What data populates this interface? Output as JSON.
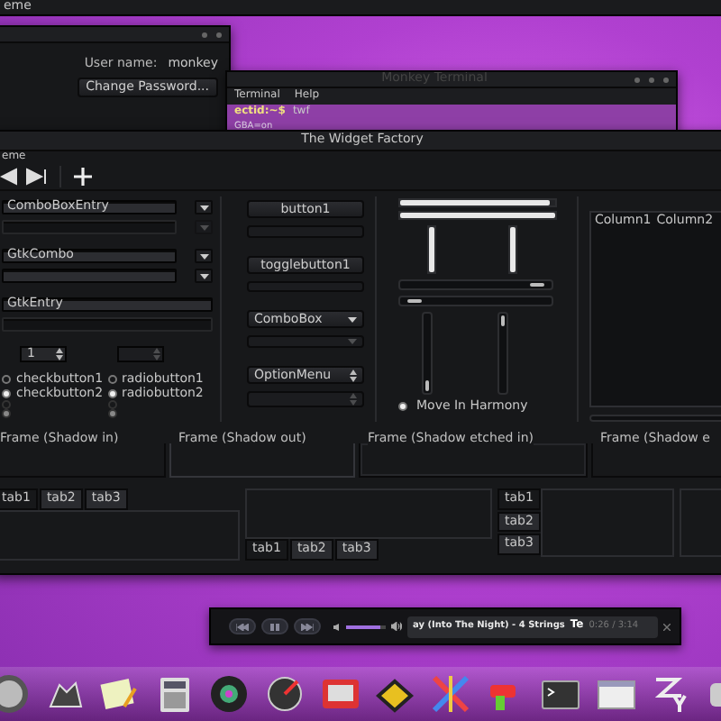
{
  "top_bar": {
    "title": "eme"
  },
  "account_window": {
    "user_label": "User name:",
    "user_value": "monkey",
    "button": "Change Password..."
  },
  "terminal_window": {
    "title": "Monkey Terminal",
    "menu": [
      "Terminal",
      "Help"
    ],
    "prompt": "ectid:~$",
    "command": "twf",
    "output": "GBA=on"
  },
  "widget_factory": {
    "title": "The Widget Factory",
    "menu_title": "eme",
    "rows": [
      {
        "kind": "combo",
        "value": "ComboBoxEntry",
        "disabled": false
      },
      {
        "kind": "combo",
        "disabled": true
      },
      {
        "kind": "combo",
        "value": "GtkCombo",
        "disabled": false
      },
      {
        "kind": "combo",
        "disabled": false
      },
      {
        "kind": "entry",
        "value": "GtkEntry",
        "disabled": false
      },
      {
        "kind": "entry",
        "disabled": true
      }
    ],
    "spin_buttons": [
      {
        "value": "1",
        "disabled": false
      },
      {
        "disabled": true
      }
    ],
    "checks": [
      {
        "label": "checkbutton1",
        "checked": false,
        "disabled": false
      },
      {
        "label": "checkbutton2",
        "checked": true,
        "disabled": false
      },
      {
        "checked": false,
        "disabled": true
      },
      {
        "checked": true,
        "disabled": true
      }
    ],
    "radios": [
      {
        "label": "radiobutton1",
        "selected": false,
        "disabled": false
      },
      {
        "label": "radiobutton2",
        "selected": true,
        "disabled": false
      },
      {
        "selected": false,
        "disabled": true
      },
      {
        "selected": true,
        "disabled": true
      }
    ],
    "buttons": [
      {
        "kind": "button",
        "label": "button1",
        "disabled": false
      },
      {
        "kind": "button",
        "disabled": true
      },
      {
        "kind": "toggle",
        "label": "togglebutton1",
        "disabled": false
      },
      {
        "kind": "toggle",
        "disabled": true
      },
      {
        "kind": "combo",
        "label": "ComboBox",
        "disabled": false
      },
      {
        "kind": "combo",
        "disabled": true
      },
      {
        "kind": "option",
        "label": "OptionMenu",
        "disabled": false
      },
      {
        "kind": "option",
        "disabled": true
      }
    ],
    "horizontal_progress_bars": [
      {
        "level": 0.96
      },
      {
        "level": 1
      }
    ],
    "vertical_progress_bars": [
      {
        "level": 1
      },
      {
        "level": 1
      }
    ],
    "horizontal_scales": [
      {
        "level": 0.95
      },
      {
        "level": 0.05
      }
    ],
    "vertical_scales": [
      {
        "level": 0.97
      },
      {
        "level": 0.03
      }
    ],
    "harmony": {
      "label": "Move In Harmony",
      "checked": true
    },
    "tree": {
      "columns": [
        "Column1",
        "Column2"
      ]
    },
    "frames": [
      "Frame (Shadow in)",
      "Frame (Shadow out)",
      "Frame (Shadow etched in)",
      "Frame (Shadow e"
    ],
    "top_notebook": {
      "tabs": [
        {
          "label": "tab1",
          "selected": true
        },
        {
          "label": "tab2",
          "selected": false
        },
        {
          "label": "tab3",
          "selected": false
        }
      ]
    },
    "bottom_notebook": {
      "tabs": [
        {
          "label": "tab1",
          "selected": true
        },
        {
          "label": "tab2",
          "selected": false
        },
        {
          "label": "tab3",
          "selected": false
        }
      ]
    },
    "side_notebook": {
      "tabs": [
        {
          "label": "tab1",
          "selected": true
        },
        {
          "label": "tab2",
          "selected": false
        },
        {
          "label": "tab3",
          "selected": false
        }
      ]
    }
  },
  "media_player": {
    "track": "ay (Into The Night) - 4 Strings",
    "next_text": "Te",
    "time": "0:26 / 3:14",
    "volume": {
      "level": 0.85
    }
  }
}
